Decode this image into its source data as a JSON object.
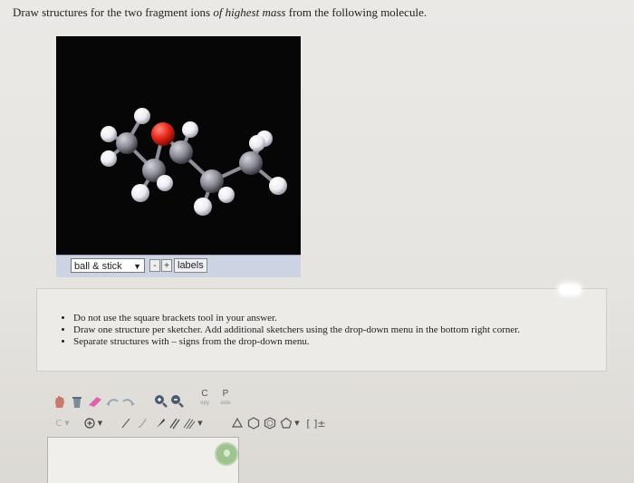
{
  "question": {
    "prefix": "Draw structures for the two fragment ions ",
    "emphasis": "of highest mass",
    "suffix": " from the following molecule."
  },
  "viewer": {
    "style_select": "ball & stick",
    "zoom_out": "-",
    "zoom_in": "+",
    "labels_button": "labels",
    "atom_colors": {
      "carbon": "#8e8e98",
      "hydrogen": "#ececf2",
      "oxygen": "#e8281b",
      "background": "#060606"
    }
  },
  "instructions": {
    "items": [
      "Do not use the square brackets tool in your answer.",
      "Draw one structure per sketcher. Add additional sketchers using the drop-down menu in the bottom right corner.",
      "Separate structures with – signs from the drop-down menu."
    ]
  },
  "toolbar": {
    "copy_label": "C",
    "copy_sub": "opy",
    "paste_label": "P",
    "paste_sub": "aste",
    "brackets_label": "[ ]±"
  }
}
